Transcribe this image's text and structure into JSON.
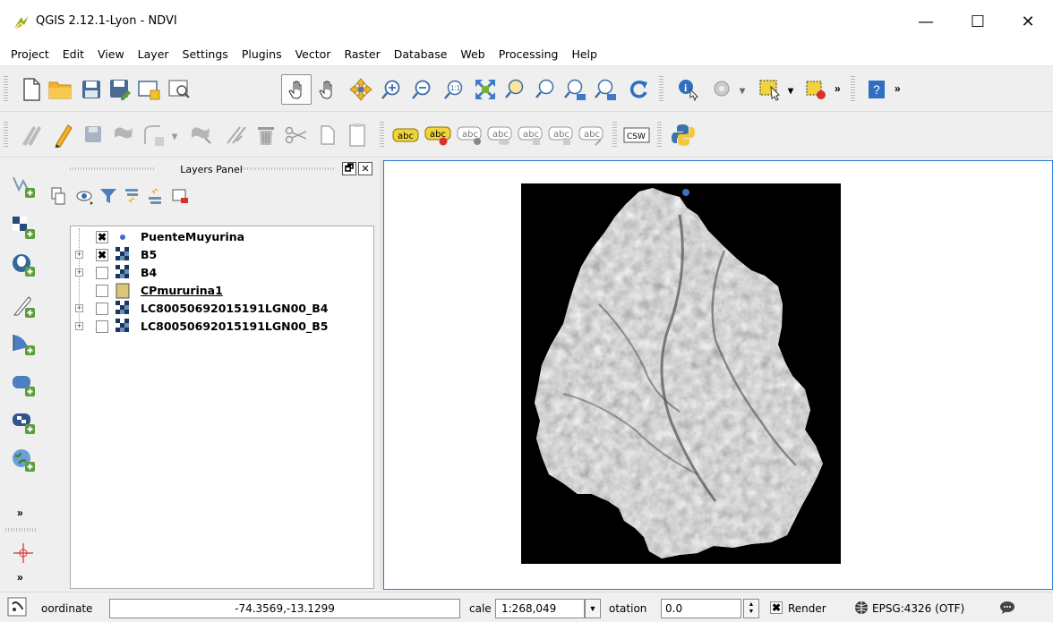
{
  "window": {
    "title": "QGIS 2.12.1-Lyon - NDVI",
    "minimize_glyph": "—",
    "maximize_glyph": "☐",
    "close_glyph": "✕"
  },
  "menu": [
    "Project",
    "Edit",
    "View",
    "Layer",
    "Settings",
    "Plugins",
    "Vector",
    "Raster",
    "Database",
    "Web",
    "Processing",
    "Help"
  ],
  "toolbar_overflow": "»",
  "label_toolbar": {
    "label_abc": "abc",
    "csw_label": "CSW"
  },
  "layers_panel": {
    "title": "Layers Panel",
    "float_glyph": "🗗",
    "close_glyph": "✕",
    "layers": [
      {
        "name": "PuenteMuyurina",
        "checked": true,
        "type": "point",
        "expandable": false
      },
      {
        "name": "B5",
        "checked": true,
        "type": "raster",
        "expandable": true
      },
      {
        "name": "B4",
        "checked": false,
        "type": "raster",
        "expandable": true
      },
      {
        "name": "CPmururina1",
        "checked": false,
        "type": "polygon",
        "expandable": false
      },
      {
        "name": "LC80050692015191LGN00_B4",
        "checked": false,
        "type": "raster",
        "expandable": true
      },
      {
        "name": "LC80050692015191LGN00_B5",
        "checked": false,
        "type": "raster",
        "expandable": true
      }
    ]
  },
  "left_toolbar_more": "»",
  "status": {
    "coordinate_label": "oordinate",
    "coordinate_value": "-74.3569,-13.1299",
    "scale_label": "cale",
    "scale_value": "1:268,049",
    "rotation_label": "otation",
    "rotation_value": "0.0",
    "render_label": "Render",
    "render_checked": true,
    "crs": "EPSG:4326 (OTF)"
  },
  "colors": {
    "accent": "#2b79d7",
    "check_mark": "#000000",
    "point_symbol": "#3f6fc9",
    "polygon_fill": "#d8c77a"
  }
}
